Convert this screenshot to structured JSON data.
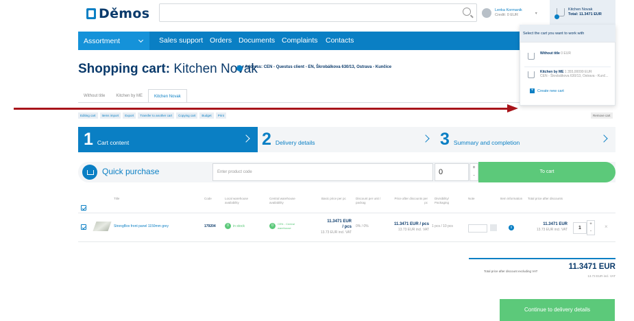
{
  "header": {
    "logo_text": "Děmos",
    "search_placeholder": "",
    "user": {
      "name": "Lenka Kormanik",
      "credit": "Credit: 0 EUR"
    },
    "cart": {
      "name": "Kitchen Novak",
      "total": "Total: 11.3471 EUR"
    }
  },
  "nav": {
    "active": "Assortment",
    "items": [
      "Sales support",
      "Orders",
      "Documents",
      "Complaints",
      "Contacts"
    ]
  },
  "page": {
    "title_prefix": "Shopping cart:",
    "title_name": "Kitchen Novak",
    "address_label": "Address:",
    "address_value": "CEN - Questus client - EN, Škrobálkova 630/13, Ostrava - Kunčice"
  },
  "tabs": [
    "Without title",
    "Kitchen by ME",
    "Kitchen Novak"
  ],
  "actions": [
    "Editing cart",
    "Items import",
    "Export",
    "Transfer to another cart",
    "Copying cart",
    "Budget",
    "Print"
  ],
  "remove_cart": "Remove cart",
  "steps": [
    {
      "num": "1",
      "label": "Cart content"
    },
    {
      "num": "2",
      "label": "Delivery details"
    },
    {
      "num": "3",
      "label": "Summary and completion"
    }
  ],
  "quick_purchase": {
    "label": "Quick purchase",
    "code_placeholder": "Enter product code",
    "qty": "0",
    "plus": "+",
    "minus": "-",
    "button": "To cart"
  },
  "table": {
    "headers": {
      "title": "Title",
      "code": "Code",
      "local": "Local warehouse availability",
      "central": "Central warehouse availability",
      "basic_price": "Basic price per pc",
      "discount": "Discount per unit / packag",
      "price_after": "Price after discounts per pc",
      "divisibility": "Divisibility/ Packaging",
      "note": "Note",
      "item_info": "Item information",
      "total": "Total price after discounts"
    },
    "rows": [
      {
        "title": "StrongBox front panel 1150mm grey",
        "code": "179204",
        "local_count": "0",
        "local_text": "in stock",
        "central_count": "0",
        "central_text": "CEN - Central warehouse",
        "basic_price": "11.3471 EUR",
        "basic_unit": "/ pcs",
        "basic_incl": "13.73 EUR incl. VAT",
        "discount": "0% / 0%",
        "price_after": "11.3471 EUR / pcs",
        "price_after_incl": "13.73 EUR incl. VAT",
        "divisibility": "1 pcs / 10 pcs",
        "info": "i",
        "total": "11.3471 EUR",
        "total_incl": "13.73 EUR incl. VAT",
        "qty": "1",
        "plus": "+",
        "minus": "-",
        "remove": "×"
      }
    ]
  },
  "summary": {
    "label": "Total price after discount excluding VAT",
    "value": "11.3471 EUR",
    "incl": "13.73 EUR incl. VAT"
  },
  "continue_button": "Continue to delivery details",
  "cart_dropdown": {
    "heading": "Select the cart you want to work with",
    "items": [
      {
        "title": "Without title",
        "meta": "0 EUR",
        "sub": ""
      },
      {
        "title": "Kitchen by ME",
        "meta": "1 355,00099 EUR",
        "sub": "CEN - Škrobálkova 630/13, Ostrava - Kunč..."
      }
    ],
    "new_cart": "Create new cart"
  },
  "colors": {
    "brand_blue": "#0a7fc4",
    "dark_blue": "#0a3a6b",
    "green": "#5cc97a",
    "annotation_red": "#a8141a"
  },
  "icons": [
    "search-icon",
    "avatar-icon",
    "cart-icon",
    "chevron-down-icon",
    "check-icon",
    "info-icon",
    "close-icon",
    "plus-icon",
    "quick-purchase-icon"
  ]
}
